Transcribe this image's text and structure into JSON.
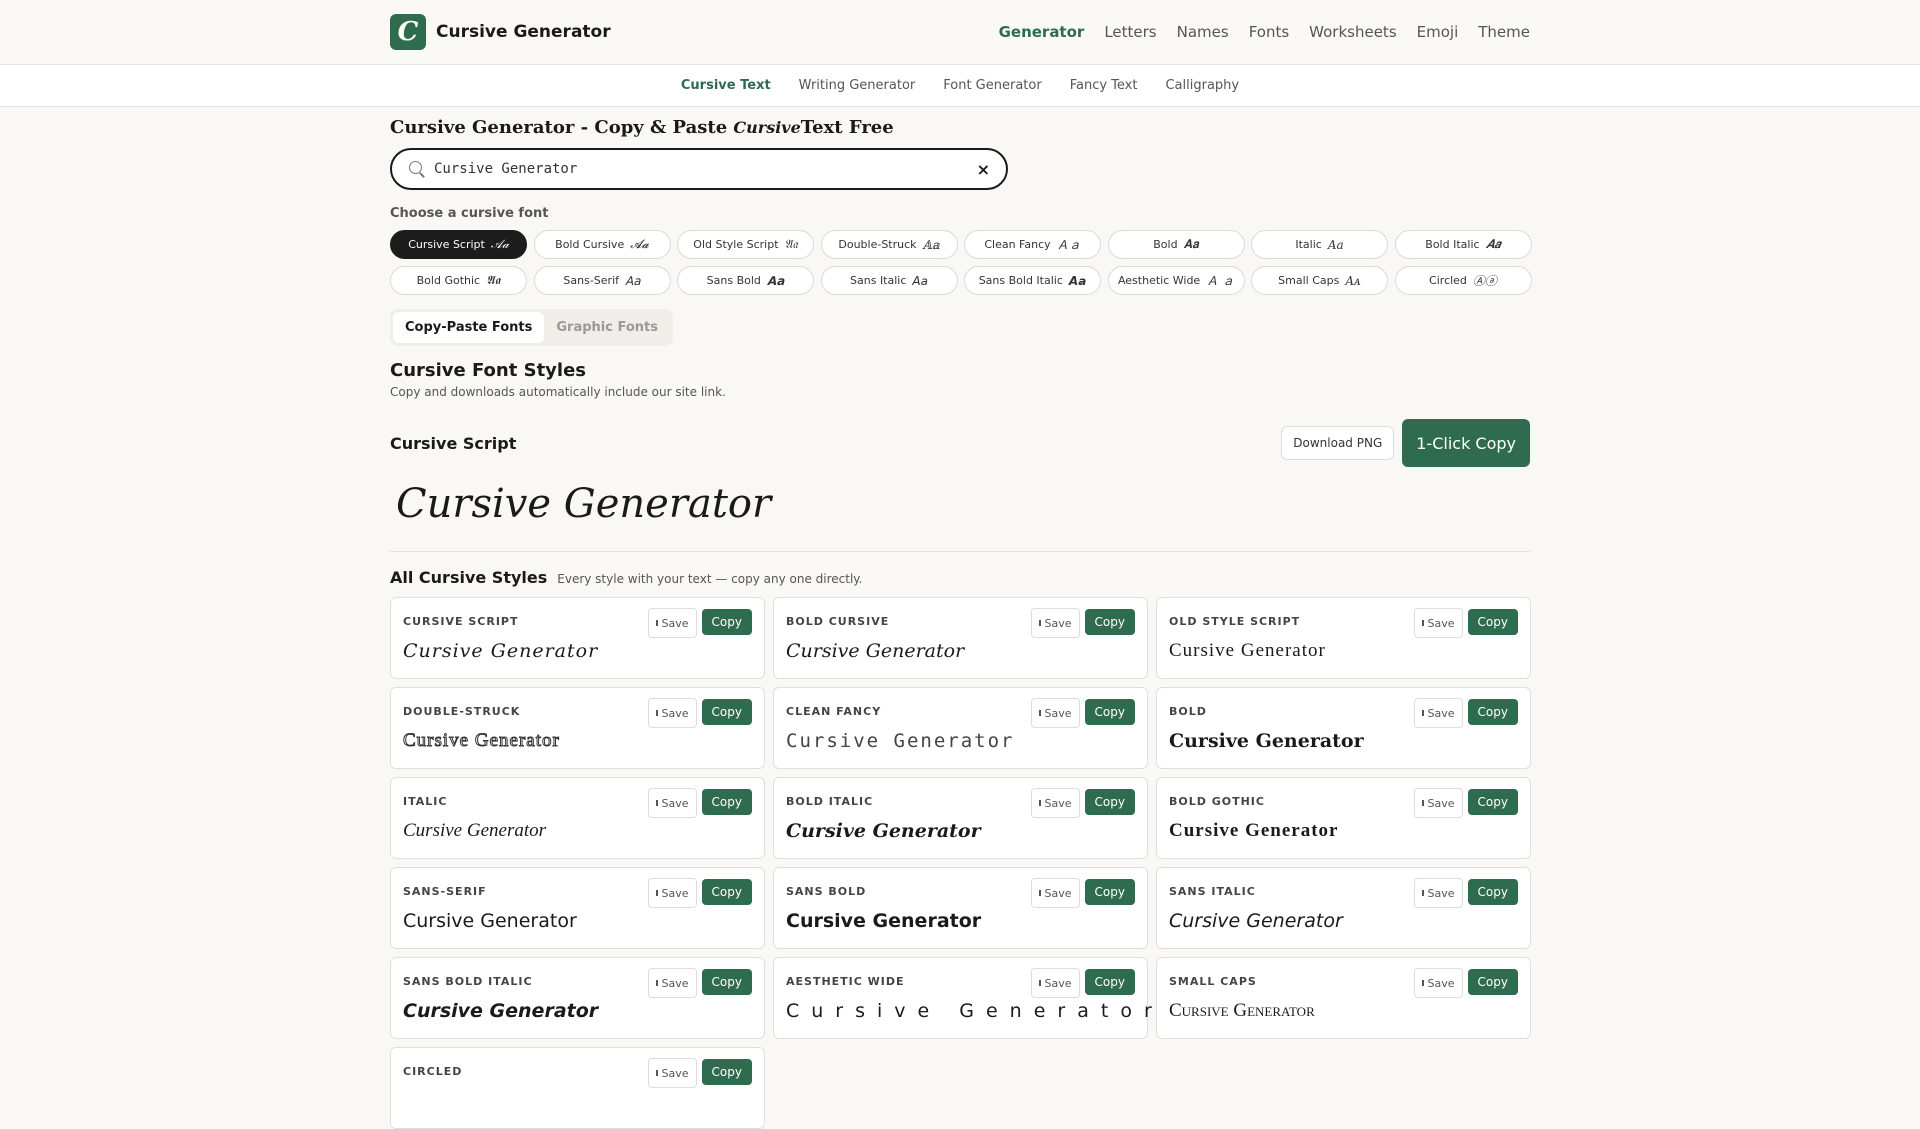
{
  "header": {
    "logo_letter": "C",
    "brand": "Cursive Generator",
    "nav": [
      "Generator",
      "Letters",
      "Names",
      "Fonts",
      "Worksheets",
      "Emoji",
      "Theme"
    ]
  },
  "subnav": [
    "Cursive Text",
    "Writing Generator",
    "Font Generator",
    "Fancy Text",
    "Calligraphy"
  ],
  "page": {
    "title_start": "Cursive Generator - Copy & Paste ",
    "title_script": "Cursive",
    "title_end": "Text Free",
    "search_value": "Cursive Generator",
    "clear": "×",
    "choose_label": "Choose a cursive font"
  },
  "chips": [
    {
      "label": "Cursive Script",
      "sample": "𝒜𝒶"
    },
    {
      "label": "Bold Cursive",
      "sample": "𝓐𝓪"
    },
    {
      "label": "Old Style Script",
      "sample": "𝔄𝔞"
    },
    {
      "label": "Double-Struck",
      "sample": "𝔸𝕒"
    },
    {
      "label": "Clean Fancy",
      "sample": "Ａａ"
    },
    {
      "label": "Bold",
      "sample": "𝐀𝐚"
    },
    {
      "label": "Italic",
      "sample": "𝐴𝑎"
    },
    {
      "label": "Bold Italic",
      "sample": "𝑨𝒂"
    },
    {
      "label": "Bold Gothic",
      "sample": "𝕬𝖆"
    },
    {
      "label": "Sans-Serif",
      "sample": "𝖠𝖺"
    },
    {
      "label": "Sans Bold",
      "sample": "𝗔𝗮"
    },
    {
      "label": "Sans Italic",
      "sample": "𝘈𝘢"
    },
    {
      "label": "Sans Bold Italic",
      "sample": "𝘼𝙖"
    },
    {
      "label": "Aesthetic Wide",
      "sample": "Ａ ａ"
    },
    {
      "label": "Small Caps",
      "sample": "Aᴀ"
    },
    {
      "label": "Circled",
      "sample": "Ⓐⓐ"
    }
  ],
  "tabs": [
    "Copy-Paste Fonts",
    "Graphic Fonts"
  ],
  "styles_section": {
    "title": "Cursive Font Styles",
    "desc": "Copy and downloads automatically include our site link."
  },
  "feature": {
    "title": "Cursive Script",
    "download": "Download PNG",
    "copy": "1-Click Copy",
    "preview": "Cursive Generator"
  },
  "all_styles": {
    "title": "All Cursive Styles",
    "desc": "Every style with your text — copy any one directly.",
    "save_label": "Save",
    "copy_label": "Copy",
    "cards": [
      {
        "name": "CURSIVE SCRIPT",
        "text": "Cursive Generator"
      },
      {
        "name": "BOLD CURSIVE",
        "text": "Cursive Generator"
      },
      {
        "name": "OLD STYLE SCRIPT",
        "text": "Cursive Generator"
      },
      {
        "name": "DOUBLE-STRUCK",
        "text": "Cursive Generator"
      },
      {
        "name": "CLEAN FANCY",
        "text": "Cursive Generator"
      },
      {
        "name": "BOLD",
        "text": "Cursive Generator"
      },
      {
        "name": "ITALIC",
        "text": "Cursive Generator"
      },
      {
        "name": "BOLD ITALIC",
        "text": "Cursive Generator"
      },
      {
        "name": "BOLD GOTHIC",
        "text": "Cursive Generator"
      },
      {
        "name": "SANS-SERIF",
        "text": "Cursive Generator"
      },
      {
        "name": "SANS BOLD",
        "text": "Cursive Generator"
      },
      {
        "name": "SANS ITALIC",
        "text": "Cursive Generator"
      },
      {
        "name": "SANS BOLD ITALIC",
        "text": "Cursive Generator"
      },
      {
        "name": "AESTHETIC WIDE",
        "text": "Cursive Generator"
      },
      {
        "name": "SMALL CAPS",
        "text": "Cursive Generator"
      },
      {
        "name": "CIRCLED",
        "text": ""
      }
    ]
  },
  "colors": {
    "accent": "#2f6b4f",
    "active_chip": "#1c1c1c",
    "background": "#f9f8f5"
  },
  "icons": [
    "search-icon",
    "close-icon",
    "bookmark-icon"
  ]
}
